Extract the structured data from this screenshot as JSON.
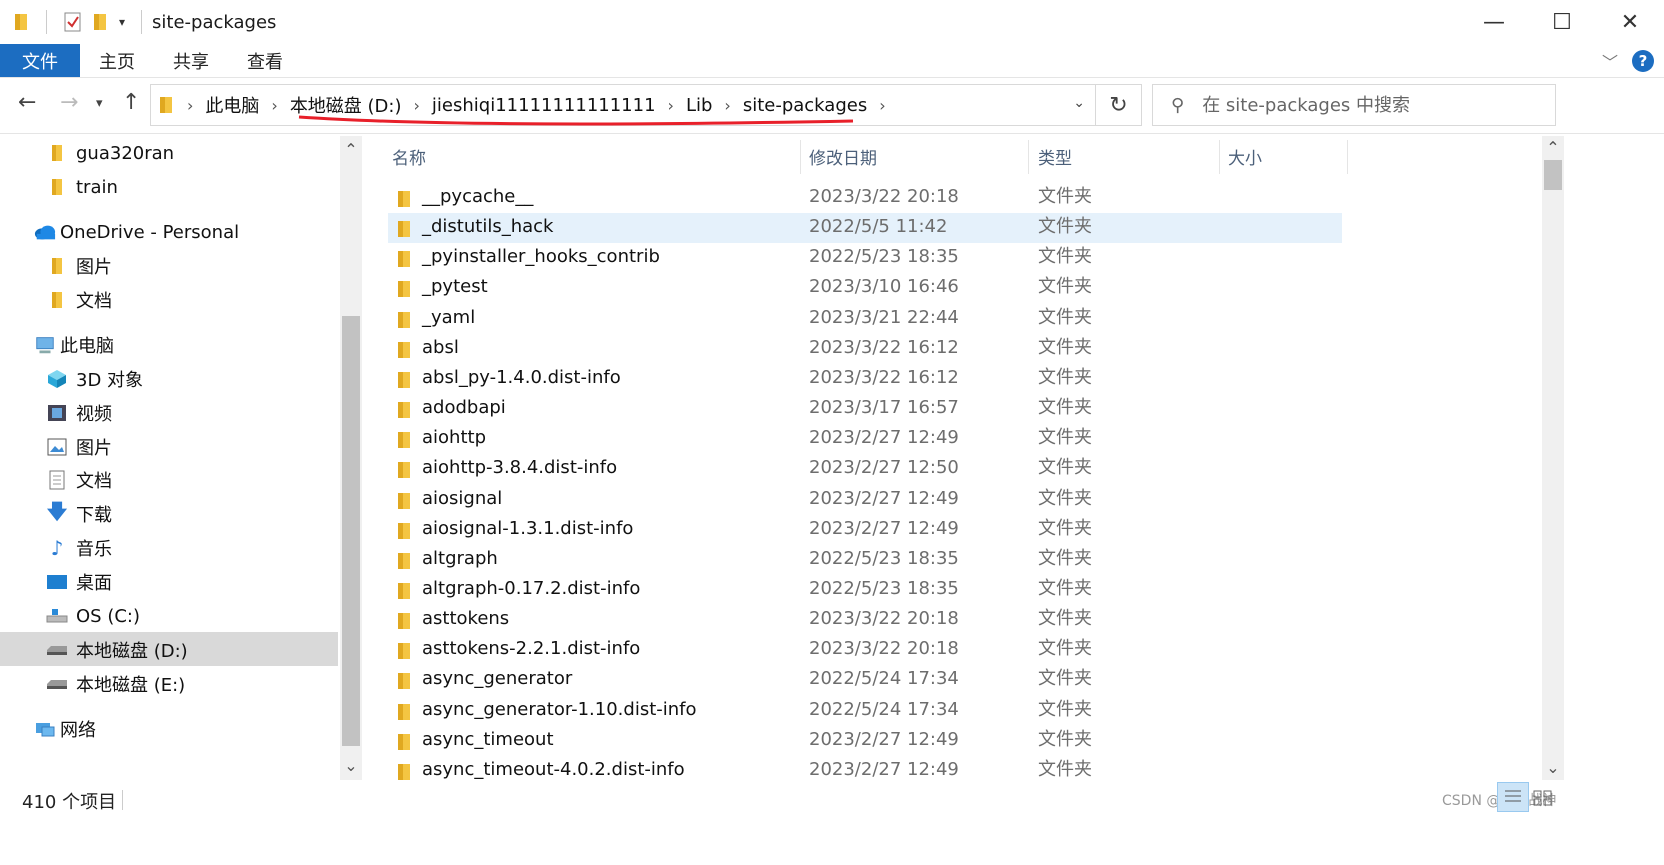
{
  "window": {
    "title": "site-packages",
    "minimize": "—",
    "maximize": "☐",
    "close": "✕"
  },
  "ribbon": {
    "tabs": [
      "文件",
      "主页",
      "共享",
      "查看"
    ]
  },
  "address": {
    "crumbs": [
      "此电脑",
      "本地磁盘 (D:)",
      "jieshiqi11111111111111",
      "Lib",
      "site-packages"
    ],
    "search_placeholder": "在 site-packages 中搜索"
  },
  "nav": {
    "items": [
      {
        "label": "gua320ran",
        "icon": "folder-icon"
      },
      {
        "label": "train",
        "icon": "folder-icon"
      },
      {
        "label": "OneDrive - Personal",
        "icon": "cloud-icon"
      },
      {
        "label": "图片",
        "icon": "folder-icon"
      },
      {
        "label": "文档",
        "icon": "folder-icon"
      },
      {
        "label": "此电脑",
        "icon": "computer-icon"
      },
      {
        "label": "3D 对象",
        "icon": "cube-icon"
      },
      {
        "label": "视频",
        "icon": "video-icon"
      },
      {
        "label": "图片",
        "icon": "pictures-icon"
      },
      {
        "label": "文档",
        "icon": "documents-icon"
      },
      {
        "label": "下载",
        "icon": "download-icon"
      },
      {
        "label": "音乐",
        "icon": "music-icon"
      },
      {
        "label": "桌面",
        "icon": "desktop-icon"
      },
      {
        "label": "OS (C:)",
        "icon": "os-drive-icon"
      },
      {
        "label": "本地磁盘 (D:)",
        "icon": "drive-icon"
      },
      {
        "label": "本地磁盘 (E:)",
        "icon": "drive-icon"
      },
      {
        "label": "网络",
        "icon": "network-icon"
      }
    ]
  },
  "columns": {
    "name": "名称",
    "date": "修改日期",
    "type": "类型",
    "size": "大小"
  },
  "files": [
    {
      "name": "__pycache__",
      "date": "2023/3/22 20:18",
      "type": "文件夹"
    },
    {
      "name": "_distutils_hack",
      "date": "2022/5/5 11:42",
      "type": "文件夹"
    },
    {
      "name": "_pyinstaller_hooks_contrib",
      "date": "2022/5/23 18:35",
      "type": "文件夹"
    },
    {
      "name": "_pytest",
      "date": "2023/3/10 16:46",
      "type": "文件夹"
    },
    {
      "name": "_yaml",
      "date": "2023/3/21 22:44",
      "type": "文件夹"
    },
    {
      "name": "absl",
      "date": "2023/3/22 16:12",
      "type": "文件夹"
    },
    {
      "name": "absl_py-1.4.0.dist-info",
      "date": "2023/3/22 16:12",
      "type": "文件夹"
    },
    {
      "name": "adodbapi",
      "date": "2023/3/17 16:57",
      "type": "文件夹"
    },
    {
      "name": "aiohttp",
      "date": "2023/2/27 12:49",
      "type": "文件夹"
    },
    {
      "name": "aiohttp-3.8.4.dist-info",
      "date": "2023/2/27 12:50",
      "type": "文件夹"
    },
    {
      "name": "aiosignal",
      "date": "2023/2/27 12:49",
      "type": "文件夹"
    },
    {
      "name": "aiosignal-1.3.1.dist-info",
      "date": "2023/2/27 12:49",
      "type": "文件夹"
    },
    {
      "name": "altgraph",
      "date": "2022/5/23 18:35",
      "type": "文件夹"
    },
    {
      "name": "altgraph-0.17.2.dist-info",
      "date": "2022/5/23 18:35",
      "type": "文件夹"
    },
    {
      "name": "asttokens",
      "date": "2023/3/22 20:18",
      "type": "文件夹"
    },
    {
      "name": "asttokens-2.2.1.dist-info",
      "date": "2023/3/22 20:18",
      "type": "文件夹"
    },
    {
      "name": "async_generator",
      "date": "2022/5/24 17:34",
      "type": "文件夹"
    },
    {
      "name": "async_generator-1.10.dist-info",
      "date": "2022/5/24 17:34",
      "type": "文件夹"
    },
    {
      "name": "async_timeout",
      "date": "2023/2/27 12:49",
      "type": "文件夹"
    },
    {
      "name": "async_timeout-4.0.2.dist-info",
      "date": "2023/2/27 12:49",
      "type": "文件夹"
    }
  ],
  "status": {
    "count": "410 个项目",
    "watermark": "CSDN @狼狂战神"
  },
  "colors": {
    "accent": "#1c6dc1",
    "selection": "#e5f1fb",
    "nav_selection": "#d9d9d9",
    "folder": "#f4c542",
    "annotation": "#e8202a"
  }
}
